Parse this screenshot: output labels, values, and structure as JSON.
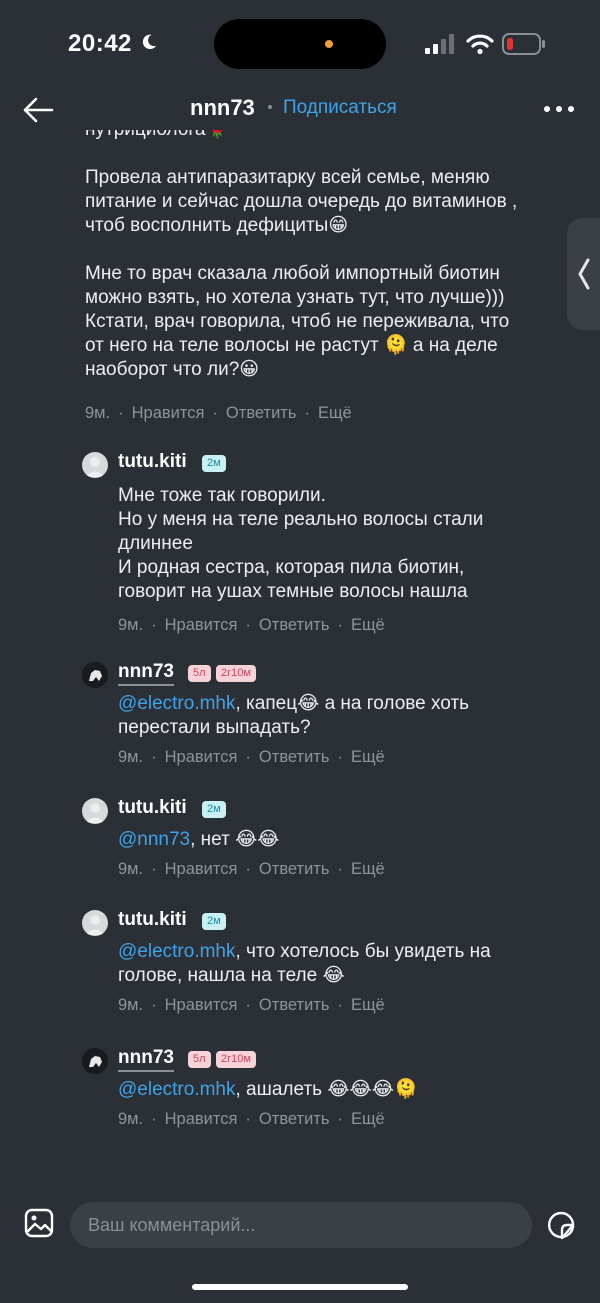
{
  "status_bar": {
    "time": "20:42"
  },
  "header": {
    "title": "nnn73",
    "subscribe_label": "Подписаться"
  },
  "post": {
    "text_lines": [
      "нутрициолога🌹",
      "",
      "Провела антипаразитарку всей семье, меняю",
      "питание и сейчас дошла очередь до витаминов ,",
      "чтоб восполнить дефициты😁",
      "",
      "Мне то врач сказала любой импортный биотин",
      "можно взять, но хотела узнать тут, что лучше)))",
      "Кстати, врач говорила, чтоб не переживала, что",
      "от него на теле волосы не растут 🫠 а на деле",
      "наоборот что ли?😀"
    ],
    "meta": {
      "time": "9м.",
      "like": "Нравится",
      "reply": "Ответить",
      "more": "Ещё"
    }
  },
  "comments": [
    {
      "username": "tutu.kiti",
      "badges": [
        "2м"
      ],
      "lines": [
        "Мне тоже так говорили.",
        "Но у меня на теле реально волосы стали",
        "длиннее",
        "И родная сестра, которая пила биотин,",
        "говорит на ушах темные волосы нашла"
      ],
      "meta": {
        "time": "9м.",
        "like": "Нравится",
        "reply": "Ответить",
        "more": "Ещё"
      }
    },
    {
      "username": "nnn73",
      "badges": [
        "5л",
        "2г10м"
      ],
      "mention": "@electro.mhk",
      "lines": [
        ", капец😂 а на голове хоть",
        "перестали выпадать?"
      ],
      "meta": {
        "time": "9м.",
        "like": "Нравится",
        "reply": "Ответить",
        "more": "Ещё"
      }
    },
    {
      "username": "tutu.kiti",
      "badges": [
        "2м"
      ],
      "mention": "@nnn73",
      "lines": [
        ", нет 😂😂"
      ],
      "meta": {
        "time": "9м.",
        "like": "Нравится",
        "reply": "Ответить",
        "more": "Ещё"
      }
    },
    {
      "username": "tutu.kiti",
      "badges": [
        "2м"
      ],
      "mention": "@electro.mhk",
      "lines": [
        ", что хотелось бы увидеть на",
        "голове, нашла на теле 😂"
      ],
      "meta": {
        "time": "9м.",
        "like": "Нравится",
        "reply": "Ответить",
        "more": "Ещё"
      }
    },
    {
      "username": "nnn73",
      "badges": [
        "5л",
        "2г10м"
      ],
      "mention": "@electro.mhk",
      "lines": [
        ", ашалеть 😂😂😂🫠"
      ],
      "meta": {
        "time": "9м.",
        "like": "Нравится",
        "reply": "Ответить",
        "more": "Ещё"
      }
    }
  ],
  "composer": {
    "placeholder": "Ваш комментарий..."
  },
  "colors": {
    "background": "#2b3036",
    "accent": "#3fa3e8",
    "muted": "#8d949b"
  }
}
